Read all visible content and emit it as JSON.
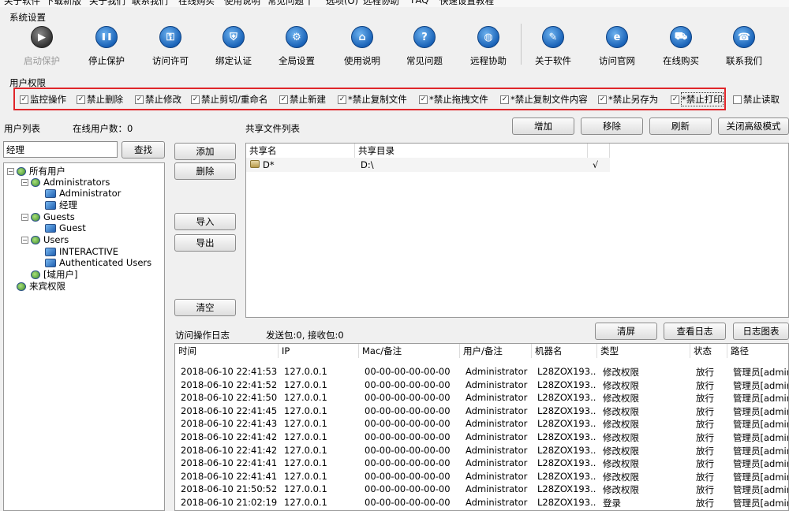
{
  "menu": {
    "items": [
      "关于软件",
      "下载新版",
      "关于我们",
      "联系我们",
      "在线购买",
      "使用说明",
      "常见问题",
      "|",
      "选项(O)",
      "远程协助",
      "FAQ",
      "快速设置教程"
    ]
  },
  "system_settings": {
    "label": "系统设置"
  },
  "toolbar": {
    "buttons": [
      {
        "label": "启动保护",
        "icon": "play-icon",
        "disabled": true
      },
      {
        "label": "停止保护",
        "icon": "pause-icon",
        "disabled": false
      },
      {
        "label": "访问许可",
        "icon": "key-icon",
        "disabled": false
      },
      {
        "label": "绑定认证",
        "icon": "shield-icon",
        "disabled": false
      },
      {
        "label": "全局设置",
        "icon": "gear-icon",
        "disabled": false
      },
      {
        "label": "使用说明",
        "icon": "graduation-cap-icon",
        "disabled": false
      },
      {
        "label": "常见问题",
        "icon": "question-icon",
        "disabled": false
      },
      {
        "label": "远程协助",
        "icon": "globe-icon",
        "disabled": false
      },
      {
        "label": "关于软件",
        "icon": "edit-icon",
        "disabled": false
      },
      {
        "label": "访问官网",
        "icon": "browser-icon",
        "disabled": false
      },
      {
        "label": "在线购买",
        "icon": "cart-icon",
        "disabled": false
      },
      {
        "label": "联系我们",
        "icon": "phone-icon",
        "disabled": false
      }
    ]
  },
  "permissions": {
    "label": "用户权限",
    "items": [
      {
        "label": "监控操作",
        "checked": true
      },
      {
        "label": "禁止删除",
        "checked": true
      },
      {
        "label": "禁止修改",
        "checked": true
      },
      {
        "label": "禁止剪切/重命名",
        "checked": true
      },
      {
        "label": "禁止新建",
        "checked": true
      },
      {
        "label": "*禁止复制文件",
        "checked": true
      },
      {
        "label": "*禁止拖拽文件",
        "checked": true
      },
      {
        "label": "*禁止复制文件内容",
        "checked": true
      },
      {
        "label": "*禁止另存为",
        "checked": true
      },
      {
        "label": "*禁止打印",
        "checked": true
      },
      {
        "label": "禁止读取",
        "checked": false
      }
    ]
  },
  "users": {
    "title": "用户列表",
    "online_count": "在线用户数：0",
    "search_value": "经理",
    "search_button": "查找",
    "tree": [
      {
        "label": "所有用户",
        "type": "group"
      },
      {
        "label": "Administrators",
        "type": "group"
      },
      {
        "label": "Administrator",
        "type": "user"
      },
      {
        "label": "经理",
        "type": "user"
      },
      {
        "label": "Guests",
        "type": "group"
      },
      {
        "label": "Guest",
        "type": "user"
      },
      {
        "label": "Users",
        "type": "group"
      },
      {
        "label": "INTERACTIVE",
        "type": "user"
      },
      {
        "label": "Authenticated Users",
        "type": "user"
      },
      {
        "label": "[域用户]",
        "type": "group"
      },
      {
        "label": "来宾权限",
        "type": "group"
      }
    ]
  },
  "middle_buttons": {
    "add": "添加",
    "delete": "删除",
    "import": "导入",
    "export": "导出",
    "clear": "清空"
  },
  "shares": {
    "title": "共享文件列表",
    "buttons": {
      "add": "增加",
      "remove": "移除",
      "refresh": "刷新",
      "close_advanced": "关闭高级模式"
    },
    "columns": [
      "共享名",
      "共享目录"
    ],
    "rows": [
      {
        "name": "D*",
        "path": "D:\\",
        "checked": "√"
      }
    ]
  },
  "log": {
    "title": "访问操作日志",
    "stats": "发送包:0, 接收包:0",
    "buttons": {
      "clear": "清屏",
      "view": "查看日志",
      "chart": "日志图表"
    },
    "columns": [
      "时间",
      "IP",
      "Mac/备注",
      "用户/备注",
      "机器名",
      "类型",
      "状态",
      "路径"
    ],
    "rows": [
      [
        "2018-06-10 22:41:53",
        "127.0.0.1",
        "00-00-00-00-00-00",
        "Administrator",
        "L28ZOX193...",
        "修改权限",
        "放行",
        "管理员[admin]"
      ],
      [
        "2018-06-10 22:41:52",
        "127.0.0.1",
        "00-00-00-00-00-00",
        "Administrator",
        "L28ZOX193...",
        "修改权限",
        "放行",
        "管理员[admin]"
      ],
      [
        "2018-06-10 22:41:50",
        "127.0.0.1",
        "00-00-00-00-00-00",
        "Administrator",
        "L28ZOX193...",
        "修改权限",
        "放行",
        "管理员[admin]"
      ],
      [
        "2018-06-10 22:41:45",
        "127.0.0.1",
        "00-00-00-00-00-00",
        "Administrator",
        "L28ZOX193...",
        "修改权限",
        "放行",
        "管理员[admin]"
      ],
      [
        "2018-06-10 22:41:43",
        "127.0.0.1",
        "00-00-00-00-00-00",
        "Administrator",
        "L28ZOX193...",
        "修改权限",
        "放行",
        "管理员[admin]"
      ],
      [
        "2018-06-10 22:41:42",
        "127.0.0.1",
        "00-00-00-00-00-00",
        "Administrator",
        "L28ZOX193...",
        "修改权限",
        "放行",
        "管理员[admin]"
      ],
      [
        "2018-06-10 22:41:42",
        "127.0.0.1",
        "00-00-00-00-00-00",
        "Administrator",
        "L28ZOX193...",
        "修改权限",
        "放行",
        "管理员[admin]"
      ],
      [
        "2018-06-10 22:41:41",
        "127.0.0.1",
        "00-00-00-00-00-00",
        "Administrator",
        "L28ZOX193...",
        "修改权限",
        "放行",
        "管理员[admin]"
      ],
      [
        "2018-06-10 22:41:41",
        "127.0.0.1",
        "00-00-00-00-00-00",
        "Administrator",
        "L28ZOX193...",
        "修改权限",
        "放行",
        "管理员[admin]"
      ],
      [
        "2018-06-10 21:50:52",
        "127.0.0.1",
        "00-00-00-00-00-00",
        "Administrator",
        "L28ZOX193...",
        "修改权限",
        "放行",
        "管理员[admin]"
      ],
      [
        "2018-06-10 21:02:19",
        "127.0.0.1",
        "00-00-00-00-00-00",
        "Administrator",
        "L28ZOX193...",
        "登录",
        "放行",
        "管理员[admin]"
      ]
    ]
  },
  "colors": {
    "highlight_border": "#e0262a",
    "icon_blue": "#1a63b8"
  }
}
